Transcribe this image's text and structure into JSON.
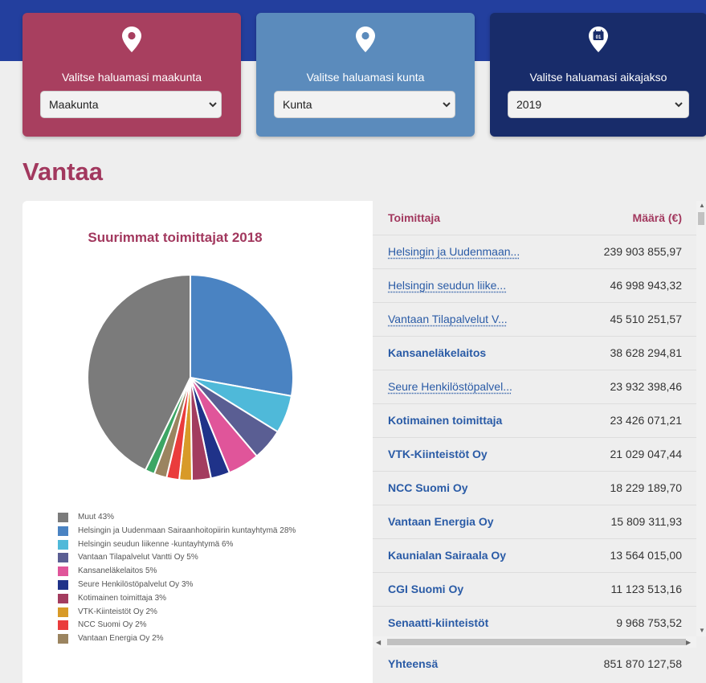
{
  "filters": [
    {
      "label": "Valitse haluamasi maakunta",
      "value": "Maakunta",
      "color": "#a83f5f"
    },
    {
      "label": "Valitse haluamasi kunta",
      "value": "Kunta",
      "color": "#5b8bbc"
    },
    {
      "label": "Valitse haluamasi aikajakso",
      "value": "2019",
      "color": "#182c6a",
      "calendar_text": "01"
    }
  ],
  "page_title": "Vantaa",
  "chart_data": {
    "type": "pie",
    "title": "Suurimmat toimittajat 2018",
    "slices": [
      {
        "label": "Muut 43%",
        "value": 43,
        "color": "#7b7b7b"
      },
      {
        "label": "Helsingin ja Uudenmaan Sairaanhoitopiirin kuntayhtymä 28%",
        "value": 28,
        "color": "#4a83c2"
      },
      {
        "label": "Helsingin seudun liikenne -kuntayhtymä 6%",
        "value": 6,
        "color": "#4fb9d9"
      },
      {
        "label": "Vantaan Tilapalvelut Vantti Oy 5%",
        "value": 5,
        "color": "#5a5e93"
      },
      {
        "label": "Kansaneläkelaitos 5%",
        "value": 5,
        "color": "#e0559a"
      },
      {
        "label": "Seure Henkilöstöpalvelut Oy 3%",
        "value": 3,
        "color": "#1f3289"
      },
      {
        "label": "Kotimainen toimittaja 3%",
        "value": 3,
        "color": "#a33c5f"
      },
      {
        "label": "VTK-Kiinteistöt Oy 2%",
        "value": 2,
        "color": "#d89a28"
      },
      {
        "label": "NCC Suomi Oy 2%",
        "value": 2,
        "color": "#ea3c3c"
      },
      {
        "label": "Vantaan Energia Oy 2%",
        "value": 2,
        "color": "#9b8460"
      },
      {
        "label": "",
        "value": 1.5,
        "color": "#3ca664"
      }
    ]
  },
  "table": {
    "header": {
      "name": "Toimittaja",
      "amount": "Määrä (€)"
    },
    "rows": [
      {
        "name": "Helsingin ja Uudenmaan...",
        "amount": "239 903 855,97",
        "link": true
      },
      {
        "name": "Helsingin seudun liike...",
        "amount": "46 998 943,32",
        "link": true
      },
      {
        "name": "Vantaan Tilapalvelut V...",
        "amount": "45 510 251,57",
        "link": true
      },
      {
        "name": "Kansaneläkelaitos",
        "amount": "38 628 294,81",
        "link": false
      },
      {
        "name": "Seure Henkilöstöpalvel...",
        "amount": "23 932 398,46",
        "link": true
      },
      {
        "name": "Kotimainen toimittaja",
        "amount": "23 426 071,21",
        "link": false
      },
      {
        "name": "VTK-Kiinteistöt Oy",
        "amount": "21 029 047,44",
        "link": false
      },
      {
        "name": "NCC Suomi Oy",
        "amount": "18 229 189,70",
        "link": false
      },
      {
        "name": "Vantaan Energia Oy",
        "amount": "15 809 311,93",
        "link": false
      },
      {
        "name": "Kaunialan Sairaala Oy",
        "amount": "13 564 015,00",
        "link": false
      },
      {
        "name": "CGI Suomi Oy",
        "amount": "11 123 513,16",
        "link": false
      },
      {
        "name": "Senaatti-kiinteistöt",
        "amount": "9 968 753,52",
        "link": false
      }
    ],
    "total": {
      "name": "Yhteensä",
      "amount": "851 870 127,58"
    }
  }
}
